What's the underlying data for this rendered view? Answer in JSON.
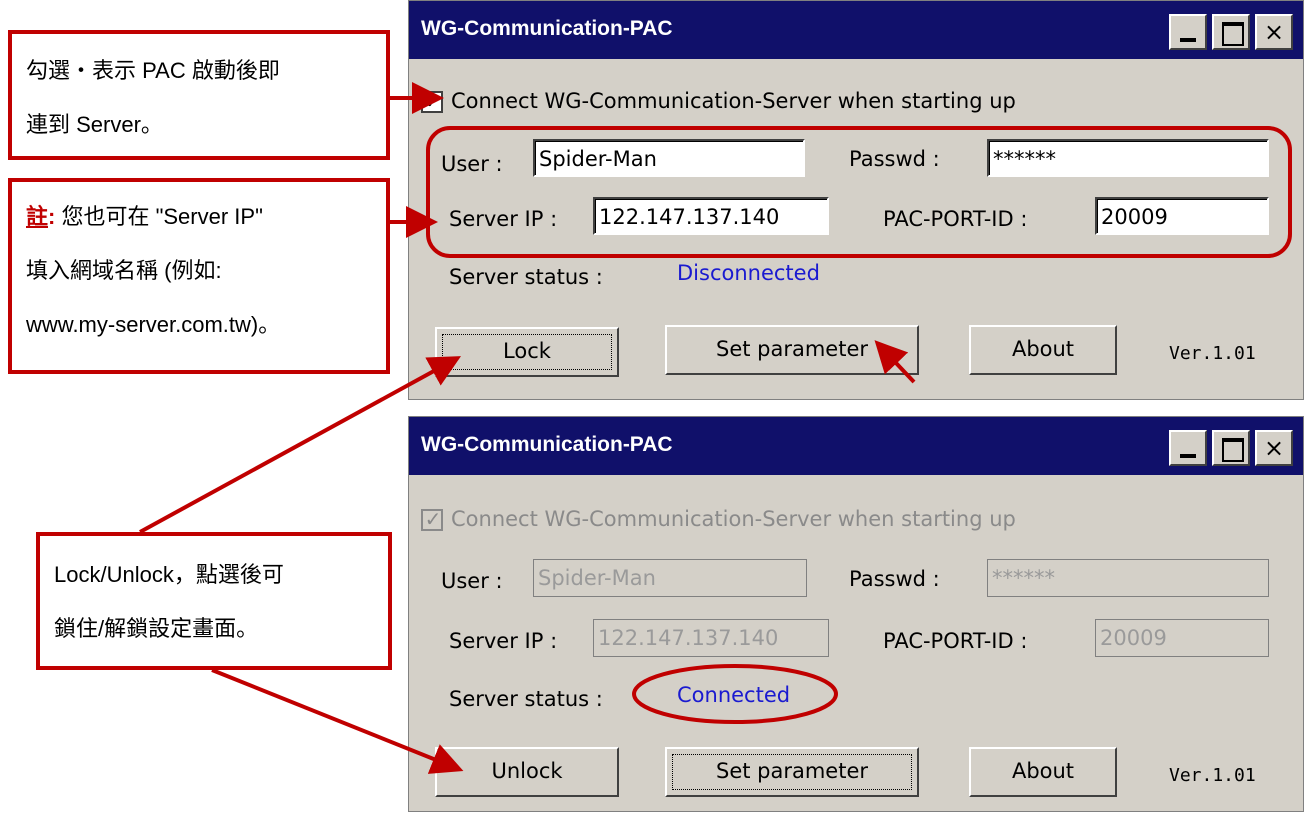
{
  "top_window": {
    "title": "WG-Communication-PAC",
    "checkbox_label": "Connect WG-Communication-Server when starting up",
    "checkbox_checked": true,
    "user_label": "User :",
    "user_value": "Spider-Man",
    "passwd_label": "Passwd :",
    "passwd_value": "******",
    "server_ip_label": "Server IP :",
    "server_ip_value": "122.147.137.140",
    "port_label": "PAC-PORT-ID :",
    "port_value": "20009",
    "status_label": "Server status :",
    "status_value": "Disconnected",
    "lock_button": "Lock",
    "set_param_button": "Set parameter",
    "about_button": "About",
    "version": "Ver.1.01"
  },
  "bottom_window": {
    "title": "WG-Communication-PAC",
    "checkbox_label": "Connect WG-Communication-Server when starting up",
    "checkbox_checked": true,
    "user_label": "User :",
    "user_value": "Spider-Man",
    "passwd_label": "Passwd :",
    "passwd_value": "******",
    "server_ip_label": "Server IP :",
    "server_ip_value": "122.147.137.140",
    "port_label": "PAC-PORT-ID :",
    "port_value": "20009",
    "status_label": "Server status :",
    "status_value": "Connected",
    "unlock_button": "Unlock",
    "set_param_button": "Set parameter",
    "about_button": "About",
    "version": "Ver.1.01"
  },
  "window_controls": {
    "minimize": "_",
    "close": "×"
  },
  "checkbox_mark": "✓",
  "callouts": {
    "startup": [
      "勾選‧表示 PAC 啟動後即",
      "連到 Server。"
    ],
    "note": {
      "key": "註",
      "colon": ":",
      "line1_rest": " 您也可在 \"Server IP\"",
      "line2": "填入網域名稱 (例如:",
      "line3": "www.my-server.com.tw)。"
    },
    "lock": [
      "Lock/Unlock，點選後可",
      "鎖住/解鎖設定畫面。"
    ]
  },
  "colors": {
    "titlebar": "#10106a",
    "dialog_bg": "#d4d0c8",
    "annotation_red": "#c00000",
    "status_blue": "#1a1ad0"
  }
}
